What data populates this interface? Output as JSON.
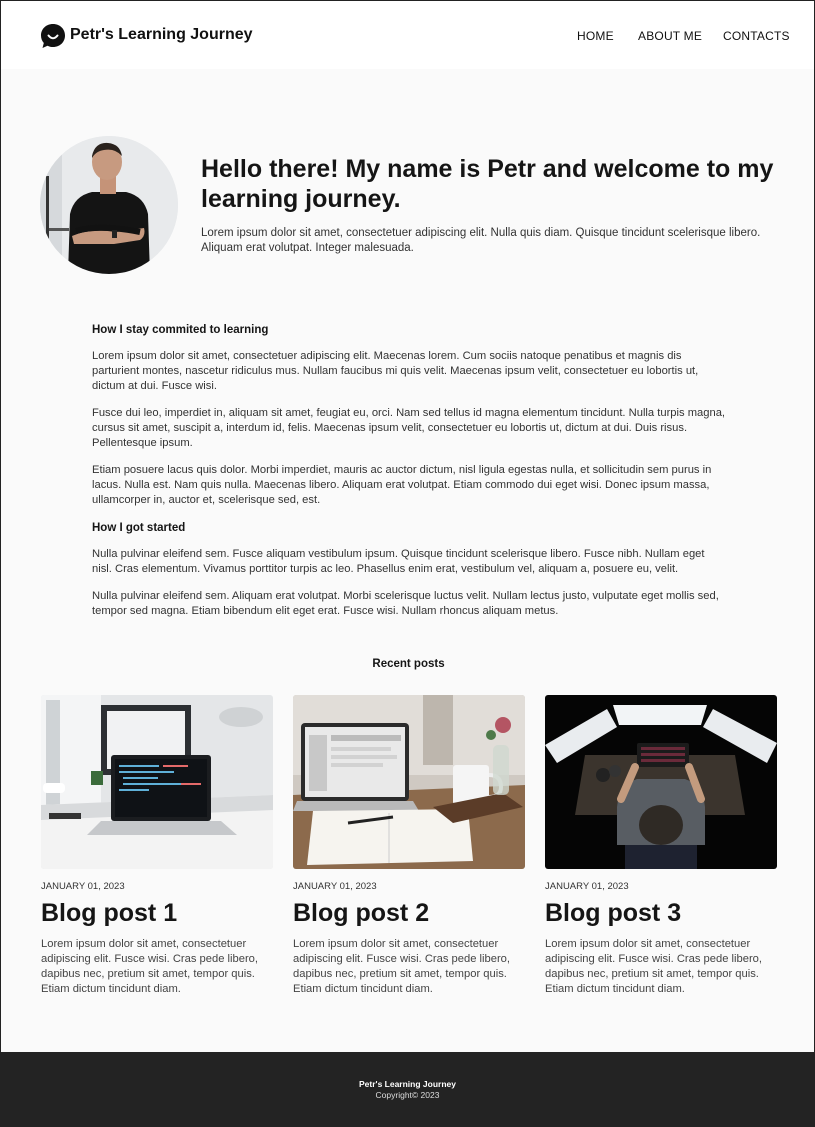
{
  "header": {
    "title": "Petr's Learning Journey",
    "nav": [
      "HOME",
      "ABOUT ME",
      "CONTACTS"
    ]
  },
  "hero": {
    "title": "Hello there! My name is Petr and welcome to my learning journey.",
    "text": "Lorem ipsum dolor sit amet, consectetuer adipiscing elit. Nulla quis diam. Quisque tincidunt scelerisque libero. Aliquam erat volutpat. Integer malesuada."
  },
  "article": {
    "heading1": "How I stay commited to learning",
    "p1": "Lorem ipsum dolor sit amet, consectetuer adipiscing elit. Maecenas lorem. Cum sociis natoque penatibus et magnis dis parturient montes, nascetur ridiculus mus. Nullam faucibus mi quis velit. Maecenas ipsum velit, consectetuer eu lobortis ut, dictum at dui. Fusce wisi.",
    "p2": "Fusce dui leo, imperdiet in, aliquam sit amet, feugiat eu, orci. Nam sed tellus id magna elementum tincidunt. Nulla turpis magna, cursus sit amet, suscipit a, interdum id, felis. Maecenas ipsum velit, consectetuer eu lobortis ut, dictum at dui. Duis risus. Pellentesque ipsum.",
    "p3": "Etiam posuere lacus quis dolor. Morbi imperdiet, mauris ac auctor dictum, nisl ligula egestas nulla, et sollicitudin sem purus in lacus. Nulla est. Nam quis nulla. Maecenas libero. Aliquam erat volutpat. Etiam commodo dui eget wisi. Donec ipsum massa, ullamcorper in, auctor et, scelerisque sed, est.",
    "heading2": "How I got started",
    "p4": "Nulla pulvinar eleifend sem. Fusce aliquam vestibulum ipsum. Quisque tincidunt scelerisque libero. Fusce nibh. Nullam eget nisl. Cras elementum. Vivamus porttitor turpis ac leo. Phasellus enim erat, vestibulum vel, aliquam a, posuere eu, velit.",
    "p5": "Nulla pulvinar eleifend sem. Aliquam erat volutpat. Morbi scelerisque luctus velit. Nullam lectus justo, vulputate eget mollis sed, tempor sed magna. Etiam bibendum elit eget erat. Fusce wisi. Nullam rhoncus aliquam metus."
  },
  "recent": {
    "title": "Recent posts",
    "posts": [
      {
        "date": "JANUARY 01, 2023",
        "title": "Blog post 1",
        "text": "Lorem ipsum dolor sit amet, consectetuer adipiscing elit. Fusce wisi. Cras pede libero, dapibus nec, pretium sit amet, tempor quis. Etiam dictum tincidunt diam."
      },
      {
        "date": "JANUARY 01, 2023",
        "title": "Blog post 2",
        "text": "Lorem ipsum dolor sit amet, consectetuer adipiscing elit. Fusce wisi. Cras pede libero, dapibus nec, pretium sit amet, tempor quis. Etiam dictum tincidunt diam."
      },
      {
        "date": "JANUARY 01, 2023",
        "title": "Blog post 3",
        "text": "Lorem ipsum dolor sit amet, consectetuer adipiscing elit. Fusce wisi. Cras pede libero, dapibus nec, pretium sit amet, tempor quis. Etiam dictum tincidunt diam."
      }
    ]
  },
  "footer": {
    "title": "Petr's Learning Journey",
    "copyright": "Copyright© 2023"
  },
  "icons": {
    "logo": "chat-bubble-smile-icon"
  },
  "colors": {
    "background": "#fafafa",
    "header": "#ffffff",
    "footer": "#232323",
    "text": "#151515"
  }
}
